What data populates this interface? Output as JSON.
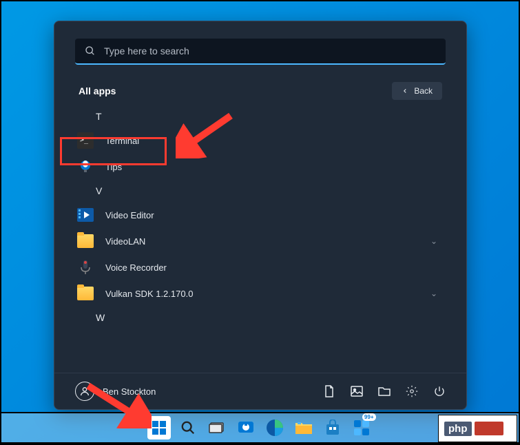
{
  "search": {
    "placeholder": "Type here to search"
  },
  "header": {
    "title": "All apps",
    "back_label": "Back"
  },
  "sections": {
    "T": {
      "letter": "T",
      "items": [
        {
          "label": "Terminal",
          "icon": "terminal"
        },
        {
          "label": "Tips",
          "icon": "tips"
        }
      ]
    },
    "V": {
      "letter": "V",
      "items": [
        {
          "label": "Video Editor",
          "icon": "video-editor"
        },
        {
          "label": "VideoLAN",
          "icon": "folder",
          "expandable": true
        },
        {
          "label": "Voice Recorder",
          "icon": "voice-recorder"
        },
        {
          "label": "Vulkan SDK 1.2.170.0",
          "icon": "folder",
          "expandable": true
        }
      ]
    },
    "W": {
      "letter": "W"
    }
  },
  "user": {
    "name": "Ben Stockton"
  },
  "taskbar": {
    "widgets_badge": "99+"
  },
  "watermark": {
    "text": "php"
  }
}
